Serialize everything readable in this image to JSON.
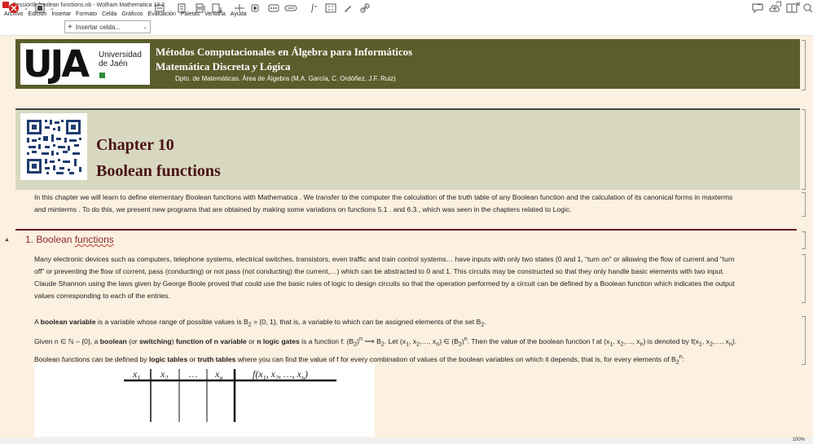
{
  "window": {
    "title": "Session9_boolean functions.nb - Wolfram Mathematica 13.2",
    "controls": [
      "–",
      "❐",
      "✕"
    ]
  },
  "menu": [
    "Archivo",
    "Edición",
    "Insertar",
    "Formato",
    "Celda",
    "Gráficos",
    "Evaluación",
    "Paletas",
    "Ventana",
    "Ayuda"
  ],
  "toolbar": {
    "insert_cell_label": "Insertar celda..."
  },
  "header": {
    "logo_text": "UJA",
    "logo_uni": "Universidad",
    "logo_jaen": "de Jaén",
    "line1": "Métodos Computacionales en Álgebra para Informáticos",
    "line2_a": "Matemática Discreta ",
    "line2_y": "y",
    "line2_b": " Lógica",
    "line3": "Dpto. de Matemáticas. Área de Álgebra (M.A. García, C. Ordóñez, J.F. Ruiz)"
  },
  "chapter": {
    "number": "Chapter 10",
    "title": "Boolean functions"
  },
  "intro": {
    "line1": "In this chapter we will learn to define elementary Boolean functions with Mathematica . We transfer to the computer the calculation of the truth table of any Boolean function and the calculation of its canonical forms in maxterms",
    "line2": "and minterms . To do this, we present new programs that are obtained by making some variations on functions 5.1 . and 6.3., which was seen in the chapters related to Logic."
  },
  "section": {
    "title_a": "1. Boolean ",
    "title_b": "functions",
    "toggle": "▲"
  },
  "body": {
    "p1_l1": "Many electronic devices such as computers, telephone systems, electrical switches, transistors, even traffic and train control systems… have inputs with only two states (0 and 1, “turn on” or allowing the flow of current and “turn",
    "p1_l2": "off” or preventing the flow of corrent, pass (conducting) or not pass (not conducting) the current,…) which can be abstracted to 0 and 1. This circuits may be constructed so that they only handle basic elements with two input.",
    "p1_l3": "Claude Shannon using the laws given by George Boole proved that could use the basic rules of logic to design circuits so that the operation performed by a circuit can be defined by a Boolean function which indicates the output",
    "p1_l4": "values corresponding to each of the entries.",
    "p2_a": "A ",
    "p2_bold": "boolean variable",
    "p2_b": " is a variable whose range of possible values is B",
    "p2_sub": "2",
    "p2_c": " = {0, 1}, that is, a variable to which can be assigned elements of the set B",
    "p2_sub2": "2",
    "p2_d": ".",
    "p3_a": "Given n ∈ ℕ – {0}, a ",
    "p3_bold1": "boolean",
    "p3_b": " (or ",
    "p3_bold2": "switching",
    "p3_c": ") ",
    "p3_bold3": "function of n variable",
    "p3_d": " or ",
    "p3_bold4": "n logic gates",
    "p3_e": " is a function f: (B",
    "p3_f": ")",
    "p3_g": " ⟶ B",
    "p3_h": ". Let (x",
    "p3_i": ", x",
    "p3_j": ",…, x",
    "p3_k": ") ∈ (B",
    "p3_l": ")",
    "p3_m": ". Then the value of the boolean function f at (x",
    "p3_n": ") is denoted by f(x",
    "p3_o": ").",
    "p4_a": "Boolean functions can be defined by ",
    "p4_bold1": "logic tables",
    "p4_b": " or ",
    "p4_bold2": "truth tables",
    "p4_c": " where you can find the value of f for every combination of values of the boolean variables on which it depends, that is, for every  elements of B",
    "p4_sup": "n",
    "p4_d": ":"
  },
  "table": {
    "headers": [
      "x",
      "x",
      "…",
      "x",
      "f(x"
    ],
    "subs": [
      "1",
      "2",
      "",
      "n"
    ],
    "f_tail": ", x",
    "f_sub1": "1",
    "f_sub2": "2",
    "f_subn": "n",
    "f_dots": ", …, x",
    "f_close": ")"
  },
  "status": {
    "zoom": "100%"
  },
  "colors": {
    "header_bg": "#5b5d2c",
    "chapter_bg": "#d8d8c0",
    "chapter_text": "#4a1414",
    "section_text": "#8b2a2a",
    "notebook_bg": "#fcf0e0"
  }
}
